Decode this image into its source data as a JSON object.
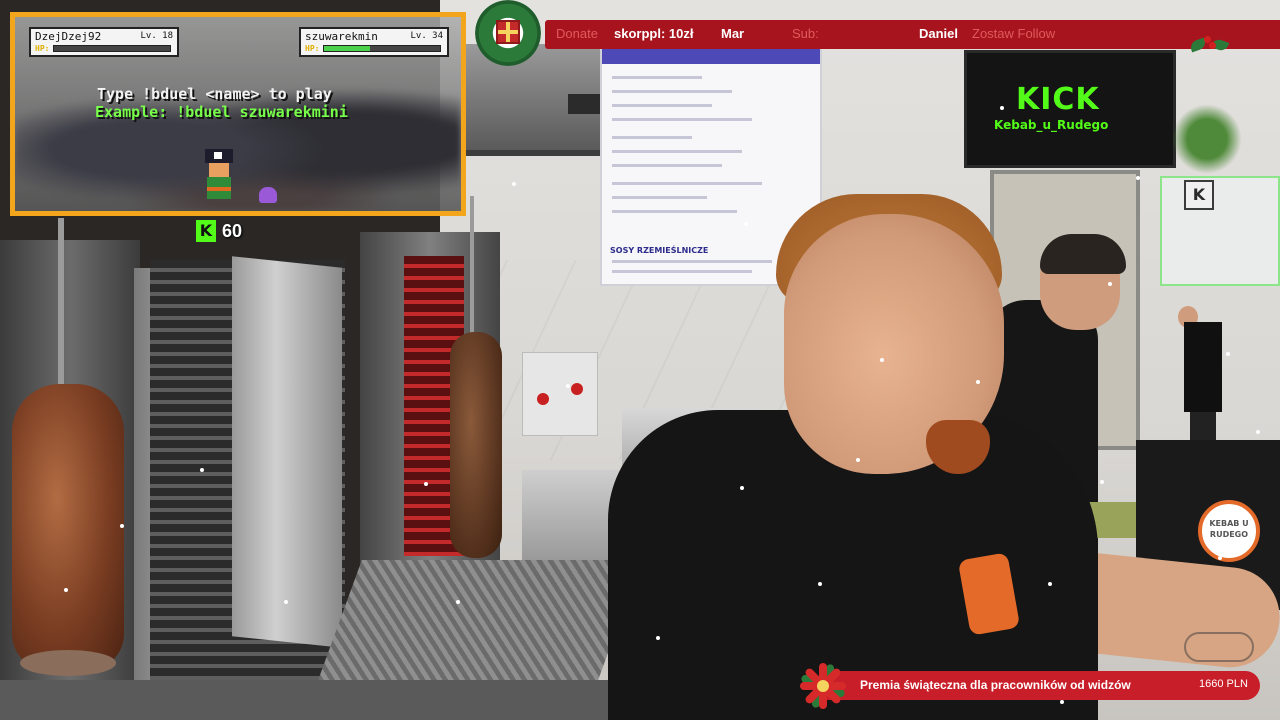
{
  "top_bar": {
    "donate_label": "Donate",
    "donate_value": "skorppl: 10zł",
    "marquee_mid": "Mar",
    "sub_label": "Sub:",
    "follow_name": "Daniel",
    "follow_label": "Zostaw Follow"
  },
  "duel_game": {
    "player1": {
      "name": "DzejDzej92",
      "level": "Lv. 18",
      "hp_label": "HP:",
      "hp_fraction": 0.0
    },
    "player2": {
      "name": "szuwarekmin",
      "level": "Lv. 34",
      "hp_label": "HP:",
      "hp_fraction": 0.4
    },
    "instruction": "Type !bduel <name> to play",
    "example": "Example: !bduel szuwarekmini",
    "border_color": "#f3a51c",
    "icons": [
      "pirate-icon",
      "octopus-icon"
    ]
  },
  "kick_viewers": {
    "icon": "kick-logo-icon",
    "count": "60",
    "accent_color": "#53fc18"
  },
  "tv_screen": {
    "brand": "KICK",
    "channel": "Kebab_u_Rudego"
  },
  "scene": {
    "sticker_text": "KEBAB U RUDEGO",
    "wall_sign_letter": "K",
    "menu_heading": "SOSY RZEMIEŚLNICZE"
  },
  "goal_bar": {
    "text": "Premia świąteczna dla pracowników od widzów",
    "amount": "1660 PLN",
    "icon": "poinsettia-icon",
    "color": "#c81e2a"
  },
  "colors": {
    "top_bar_bg": "#a8141e",
    "label_red": "#e05a5a"
  }
}
